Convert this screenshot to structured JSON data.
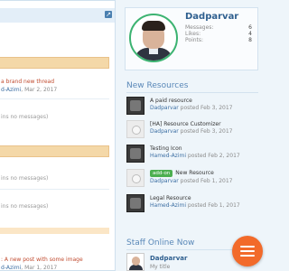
{
  "left_panel": {
    "expand_icon": "expand-icon",
    "items": [
      {
        "thread": "a brand new thread",
        "author": "d-Azimi",
        "date": ", Mar 2, 2017"
      },
      {
        "no_messages": "ins no messages)"
      },
      {
        "no_messages": "ins no messages)"
      },
      {
        "no_messages": "ins no messages)"
      },
      {
        "thread": ": A new post with some image",
        "author": "d-Azimi",
        "date": ", Mar 1, 2017"
      }
    ]
  },
  "profile": {
    "name": "Dadparvar",
    "stats": [
      {
        "label": "Messages:",
        "value": "6"
      },
      {
        "label": "Likes:",
        "value": "4"
      },
      {
        "label": "Points:",
        "value": "8"
      }
    ]
  },
  "new_resources": {
    "header": "New Resources",
    "items": [
      {
        "title": "A paid resource",
        "author": "Dadparvar",
        "meta": " posted Feb 3, 2017",
        "thumb": "dark"
      },
      {
        "title": "[HA] Resource Customizer",
        "author": "Dadparvar",
        "meta": " posted Feb 3, 2017",
        "thumb": "light"
      },
      {
        "title": "Testing Icon",
        "author": "Hamed-Azimi",
        "meta": " posted Feb 2, 2017",
        "thumb": "dark"
      },
      {
        "prefix": "add-on",
        "title": "New Resource",
        "author": "Dadparvar",
        "meta": " posted Feb 1, 2017",
        "thumb": "light"
      },
      {
        "title": "Legal Resource",
        "author": "Hamed-Azimi",
        "meta": " posted Feb 1, 2017",
        "thumb": "dark"
      }
    ]
  },
  "staff_online": {
    "header": "Staff Online Now",
    "name": "Dadparvar",
    "title": "My title"
  },
  "colors": {
    "accent": "#5a88b8",
    "fab": "#f26a2a",
    "avatar_ring": "#3cb371",
    "category_bar": "#f4d8a8"
  }
}
